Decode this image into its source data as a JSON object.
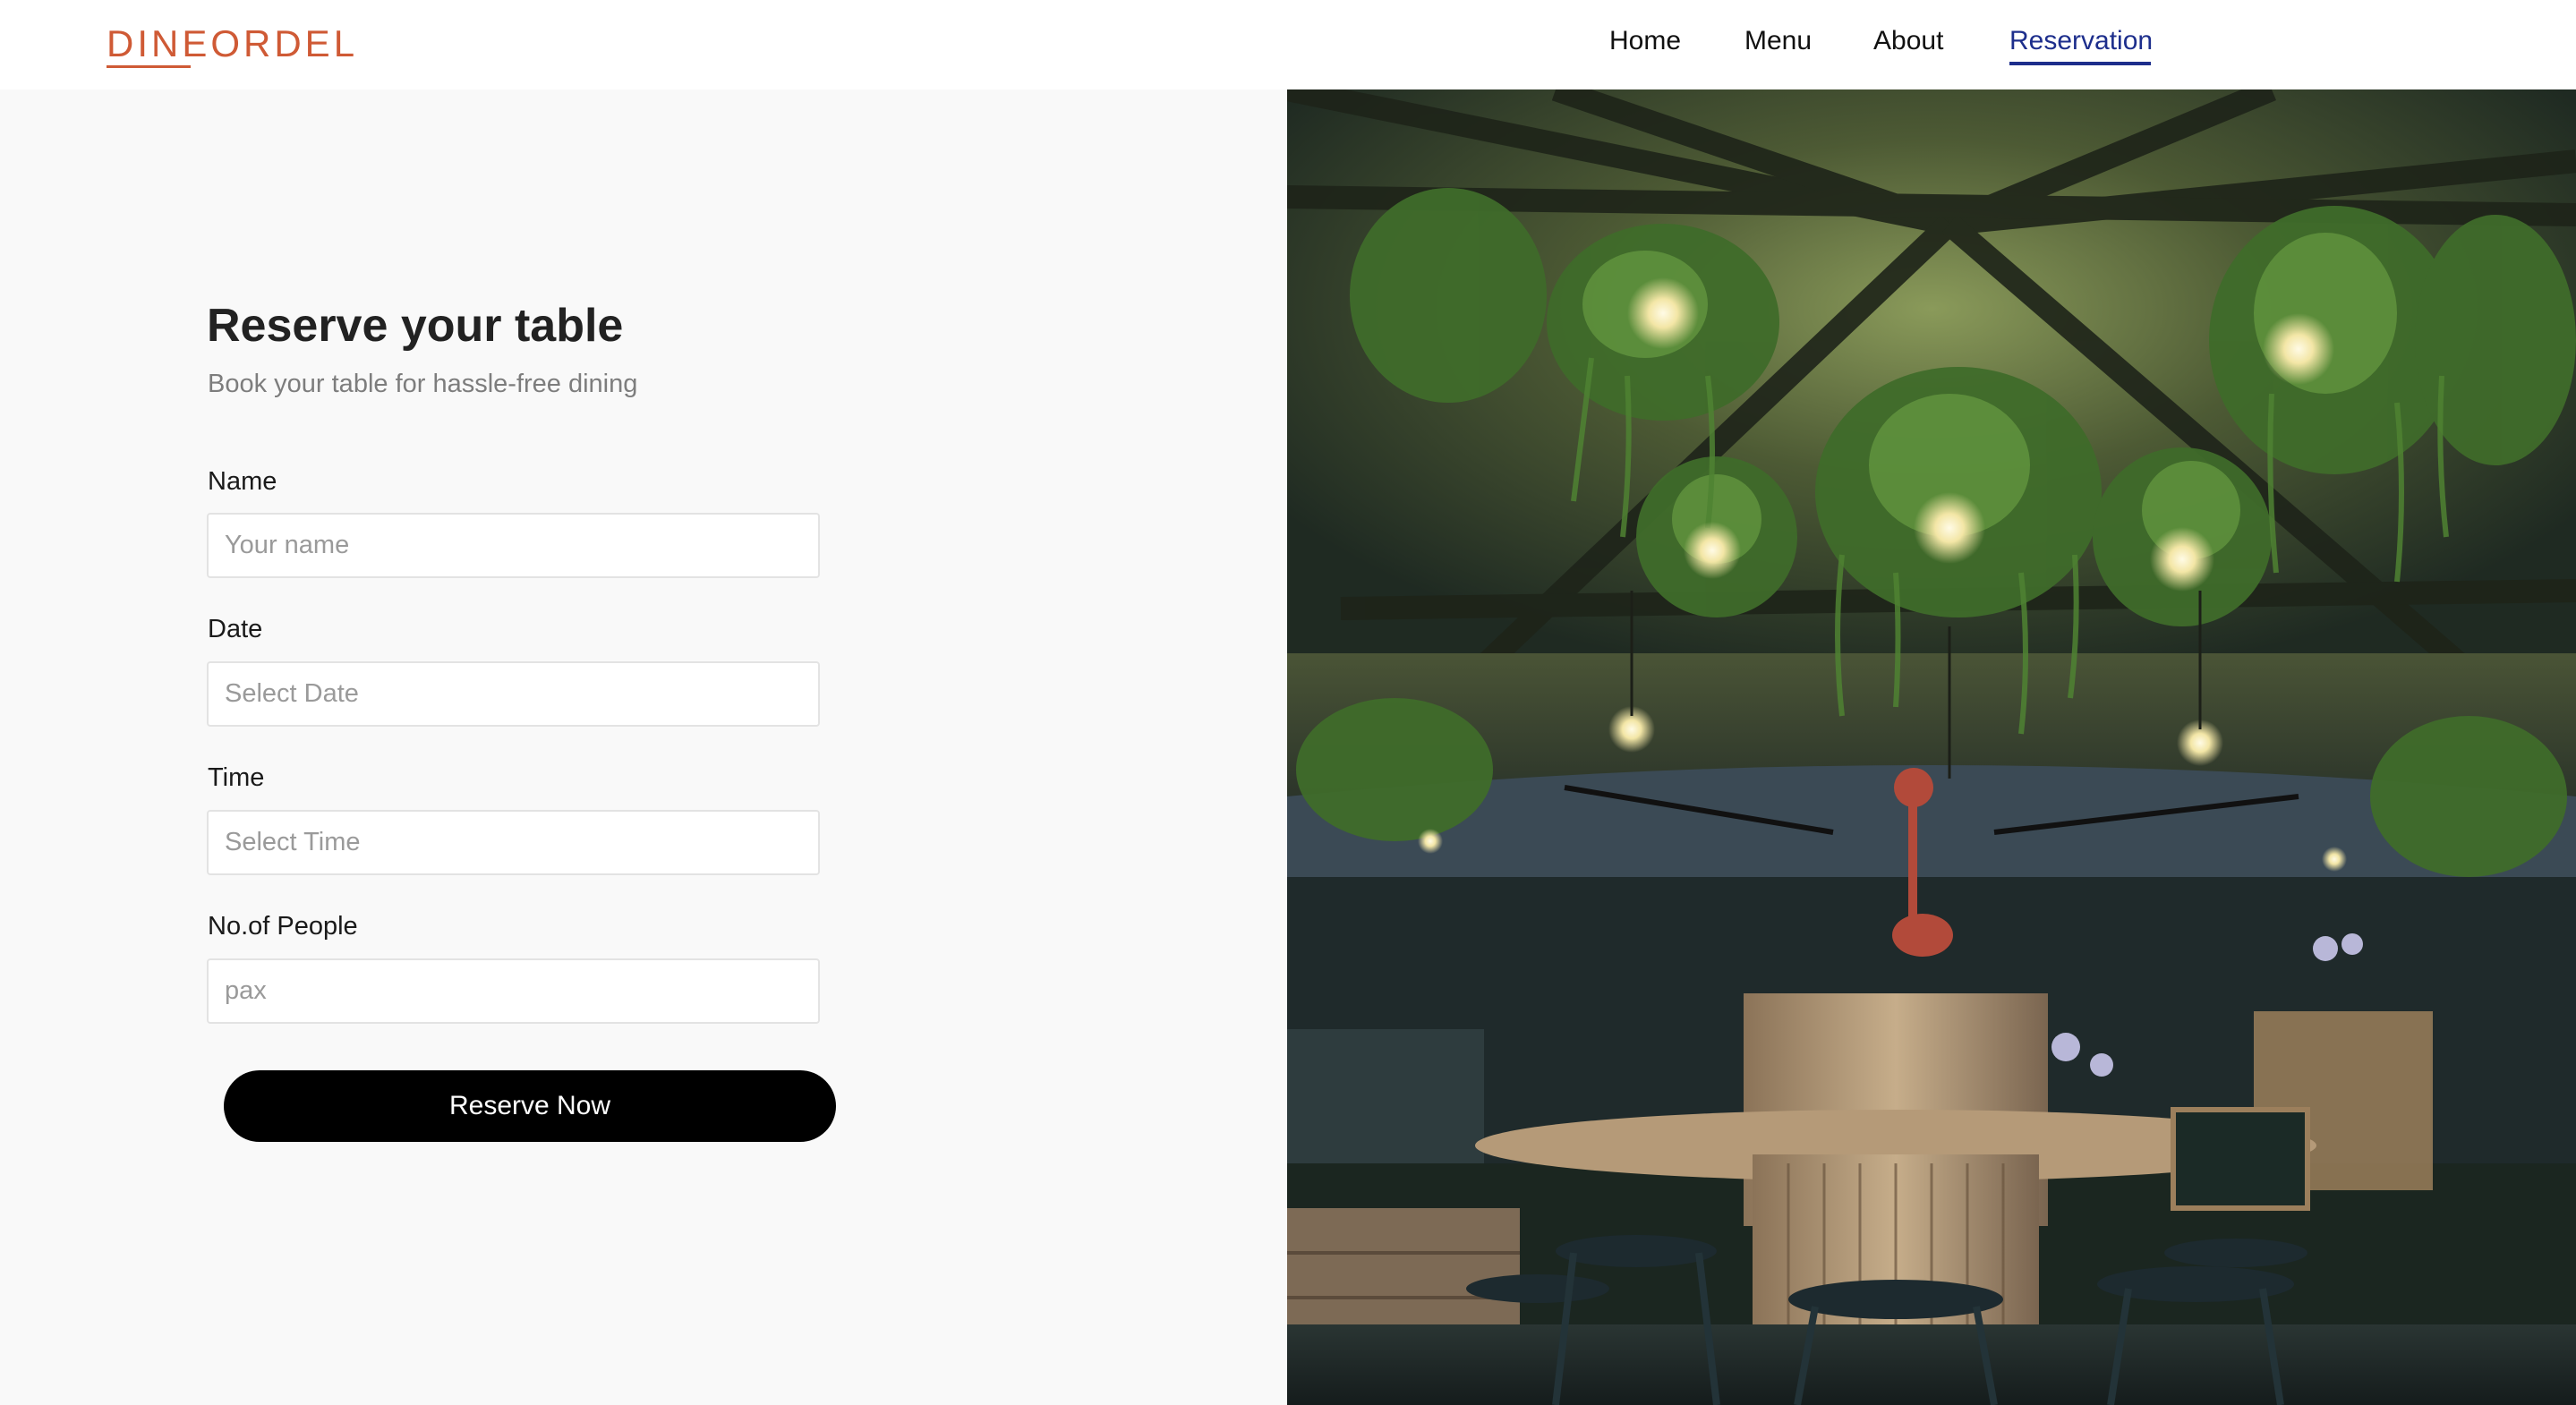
{
  "header": {
    "logo": "DINEORDEL",
    "nav": {
      "home": "Home",
      "menu": "Menu",
      "about": "About",
      "reservation": "Reservation",
      "active": "Reservation"
    }
  },
  "form": {
    "title": "Reserve your table",
    "subtitle": "Book your table for hassle-free dining",
    "name": {
      "label": "Name",
      "placeholder": "Your name",
      "value": ""
    },
    "date": {
      "label": "Date",
      "placeholder": "Select Date",
      "value": ""
    },
    "time": {
      "label": "Time",
      "placeholder": "Select Time",
      "value": ""
    },
    "people": {
      "label": "No.of People",
      "placeholder": "pax",
      "value": ""
    },
    "submit_label": "Reserve Now"
  },
  "colors": {
    "brand": "#cf5a35",
    "nav_active": "#1d2e8c",
    "button": "#000000",
    "page_bg": "#f9f9f9"
  }
}
